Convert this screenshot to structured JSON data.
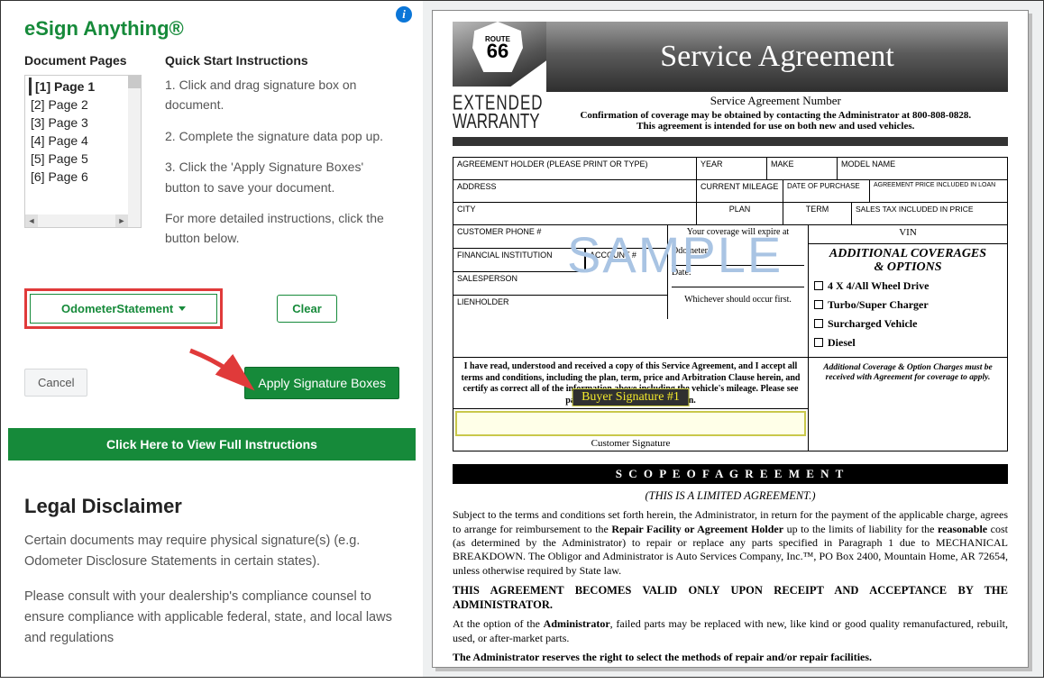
{
  "app": {
    "title": "eSign Anything®",
    "info_tooltip": "i"
  },
  "pages": {
    "heading": "Document Pages",
    "items": [
      {
        "label": "[1] Page 1",
        "active": true
      },
      {
        "label": "[2] Page 2",
        "active": false
      },
      {
        "label": "[3] Page 3",
        "active": false
      },
      {
        "label": "[4] Page 4",
        "active": false
      },
      {
        "label": "[5] Page 5",
        "active": false
      },
      {
        "label": "[6] Page 6",
        "active": false
      }
    ]
  },
  "instructions": {
    "heading": "Quick Start Instructions",
    "steps": [
      "1. Click and drag signature box on document.",
      "2. Complete the signature data pop up.",
      "3. Click the 'Apply Signature Boxes' button to save your document."
    ],
    "more": "For more detailed instructions, click the button below."
  },
  "controls": {
    "dropdown_label": "OdometerStatement",
    "clear": "Clear",
    "cancel": "Cancel",
    "apply": "Apply Signature Boxes",
    "full_instructions": "Click Here to View Full Instructions"
  },
  "disclaimer": {
    "heading": "Legal Disclaimer",
    "p1": "Certain documents may require physical signature(s) (e.g. Odometer Disclosure Statements in certain states).",
    "p2": "Please consult with your dealership's compliance counsel to ensure compliance with applicable federal, state, and local laws and regulations"
  },
  "document": {
    "route": {
      "label": "ROUTE",
      "num": "66"
    },
    "ext1": "EXTENDED",
    "ext2": "WARRANTY",
    "title": "Service Agreement",
    "sa_number": "Service Agreement Number",
    "conf1": "Confirmation of coverage may be obtained by contacting the Administrator at 800-808-0828.",
    "conf2": "This agreement is intended for use on both new and used vehicles.",
    "fields": {
      "holder": "AGREEMENT HOLDER (PLEASE PRINT OR TYPE)",
      "year": "YEAR",
      "make": "MAKE",
      "model": "MODEL NAME",
      "address": "ADDRESS",
      "mileage": "CURRENT MILEAGE",
      "dop": "DATE OF PURCHASE",
      "priceloan": "AGREEMENT PRICE INCLUDED IN LOAN",
      "city": "CITY",
      "plan": "PLAN",
      "term": "TERM",
      "tax": "SALES TAX INCLUDED IN PRICE",
      "phone": "CUSTOMER PHONE #",
      "fin": "FINANCIAL INSTITUTION",
      "acct": "ACCOUNT #",
      "sales": "SALESPERSON",
      "lien": "LIENHOLDER",
      "vin": "VIN",
      "expire": "Your coverage will expire at",
      "odo": "Odometer:",
      "date": "Date:",
      "whichever": "Whichever should occur first."
    },
    "options": {
      "heading1": "ADDITIONAL COVERAGES",
      "heading2": "& OPTIONS",
      "items": [
        "4 X 4/All Wheel Drive",
        "Turbo/Super Charger",
        "Surcharged Vehicle",
        "Diesel"
      ],
      "note": "Additional Coverage & Option Charges must be received with Agreement for coverage to apply."
    },
    "watermark": "SAMPLE",
    "declare": "I have read, understood and received a copy of this Service Agreement, and I accept all terms and conditions, including the plan, term, price and Arbitration Clause herein, and certify as correct all of the information above including the vehicle's mileage.  Please see page 2 for important information.",
    "sig_overlay": "Buyer Signature #1",
    "sig_caption": "Customer Signature",
    "scope": "S C O P E O F A G R E E M E N T",
    "limited": "(THIS IS A LIMITED AGREEMENT.)",
    "body1a": "Subject to the terms and conditions set forth herein, the Administrator, in return for the payment of the applicable charge, agrees to arrange for reimbursement to the ",
    "body1b": "Repair Facility or Agreement Holder",
    "body1c": " up to the limits of liability for the ",
    "body1d": "reasonable",
    "body1e": " cost (as determined by the Administrator) to repair or replace any parts specified in Paragraph 1 due to MECHANICAL BREAKDOWN. The Obligor and Administrator is Auto Services Company, Inc.™, PO Box 2400, Mountain Home, AR  72654, unless otherwise required by State law.",
    "valid": "THIS AGREEMENT BECOMES VALID ONLY UPON RECEIPT AND ACCEPTANCE BY THE ADMINISTRATOR.",
    "body2a": "At the option of the ",
    "body2b": "Administrator",
    "body2c": ", failed parts may be replaced with new, like kind or good quality remanufactured, rebuilt, used, or after-market parts.",
    "body3": "The Administrator reserves the right to select the methods of repair and/or repair facilities."
  }
}
